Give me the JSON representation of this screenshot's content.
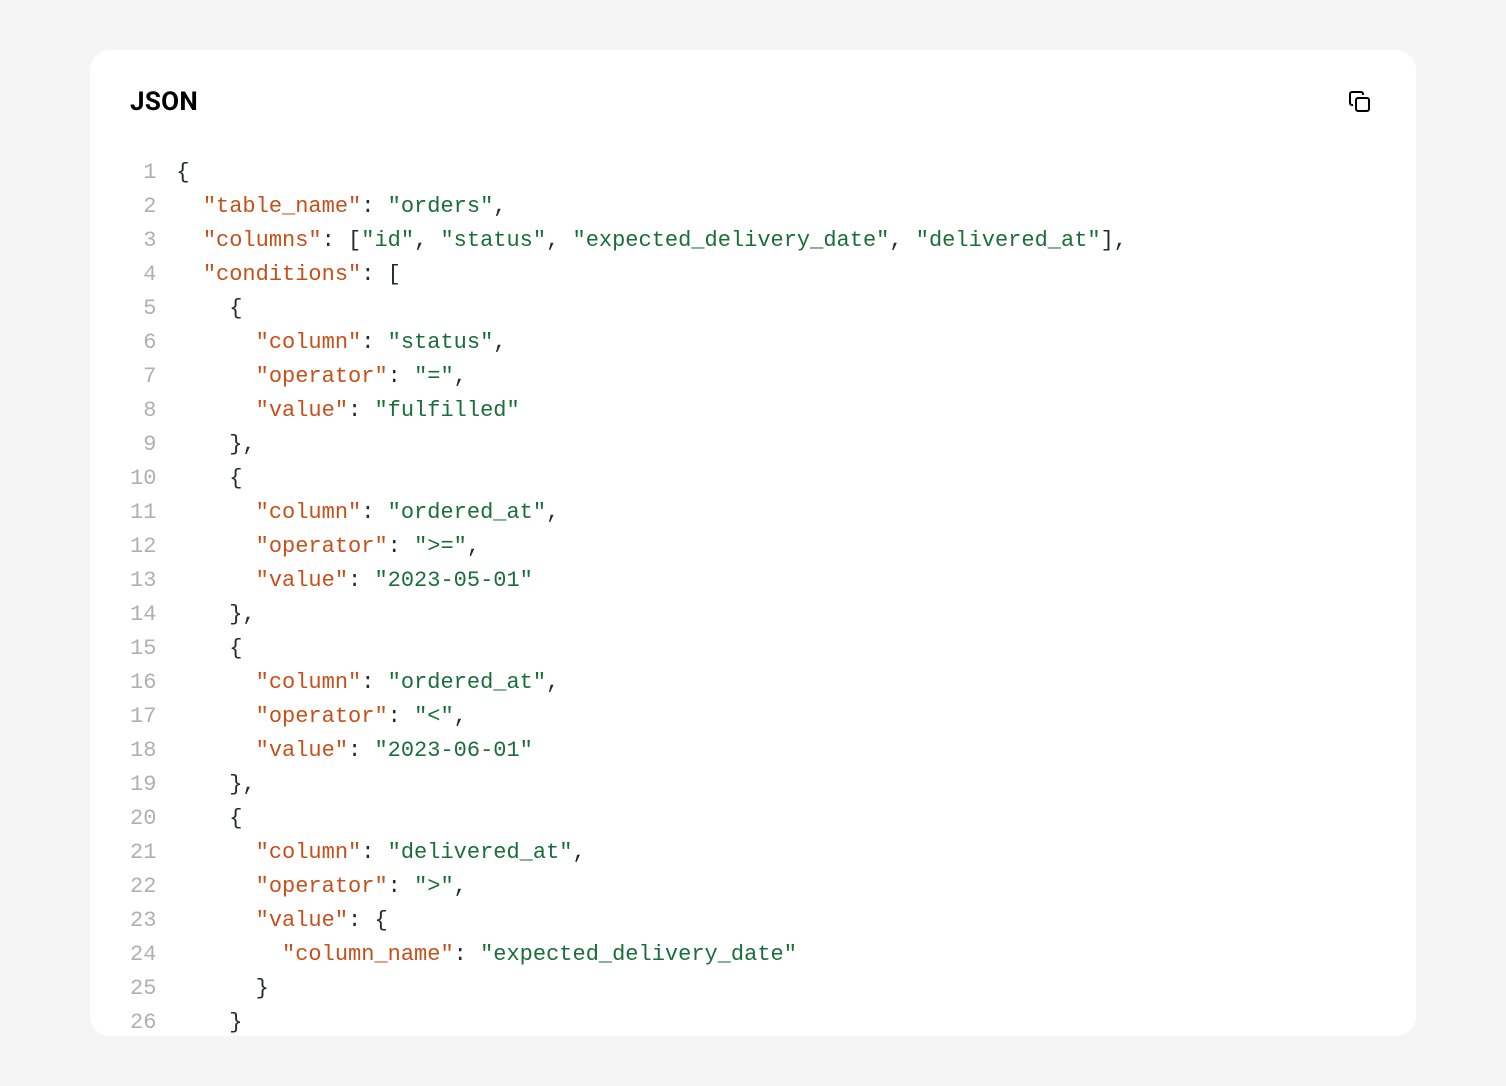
{
  "header": {
    "language_label": "JSON"
  },
  "code": {
    "line_numbers": [
      "1",
      "2",
      "3",
      "4",
      "5",
      "6",
      "7",
      "8",
      "9",
      "10",
      "11",
      "12",
      "13",
      "14",
      "15",
      "16",
      "17",
      "18",
      "19",
      "20",
      "21",
      "22",
      "23",
      "24",
      "25",
      "26"
    ],
    "lines": [
      [
        {
          "t": "punct",
          "v": "{"
        }
      ],
      [
        {
          "t": "indent",
          "v": "  "
        },
        {
          "t": "key",
          "v": "\"table_name\""
        },
        {
          "t": "punct",
          "v": ": "
        },
        {
          "t": "string",
          "v": "\"orders\""
        },
        {
          "t": "punct",
          "v": ","
        }
      ],
      [
        {
          "t": "indent",
          "v": "  "
        },
        {
          "t": "key",
          "v": "\"columns\""
        },
        {
          "t": "punct",
          "v": ": ["
        },
        {
          "t": "string",
          "v": "\"id\""
        },
        {
          "t": "punct",
          "v": ", "
        },
        {
          "t": "string",
          "v": "\"status\""
        },
        {
          "t": "punct",
          "v": ", "
        },
        {
          "t": "string",
          "v": "\"expected_delivery_date\""
        },
        {
          "t": "punct",
          "v": ", "
        },
        {
          "t": "string",
          "v": "\"delivered_at\""
        },
        {
          "t": "punct",
          "v": "],"
        }
      ],
      [
        {
          "t": "indent",
          "v": "  "
        },
        {
          "t": "key",
          "v": "\"conditions\""
        },
        {
          "t": "punct",
          "v": ": ["
        }
      ],
      [
        {
          "t": "indent",
          "v": "    "
        },
        {
          "t": "punct",
          "v": "{"
        }
      ],
      [
        {
          "t": "indent",
          "v": "      "
        },
        {
          "t": "key",
          "v": "\"column\""
        },
        {
          "t": "punct",
          "v": ": "
        },
        {
          "t": "string",
          "v": "\"status\""
        },
        {
          "t": "punct",
          "v": ","
        }
      ],
      [
        {
          "t": "indent",
          "v": "      "
        },
        {
          "t": "key",
          "v": "\"operator\""
        },
        {
          "t": "punct",
          "v": ": "
        },
        {
          "t": "string",
          "v": "\"=\""
        },
        {
          "t": "punct",
          "v": ","
        }
      ],
      [
        {
          "t": "indent",
          "v": "      "
        },
        {
          "t": "key",
          "v": "\"value\""
        },
        {
          "t": "punct",
          "v": ": "
        },
        {
          "t": "string",
          "v": "\"fulfilled\""
        }
      ],
      [
        {
          "t": "indent",
          "v": "    "
        },
        {
          "t": "punct",
          "v": "},"
        }
      ],
      [
        {
          "t": "indent",
          "v": "    "
        },
        {
          "t": "punct",
          "v": "{"
        }
      ],
      [
        {
          "t": "indent",
          "v": "      "
        },
        {
          "t": "key",
          "v": "\"column\""
        },
        {
          "t": "punct",
          "v": ": "
        },
        {
          "t": "string",
          "v": "\"ordered_at\""
        },
        {
          "t": "punct",
          "v": ","
        }
      ],
      [
        {
          "t": "indent",
          "v": "      "
        },
        {
          "t": "key",
          "v": "\"operator\""
        },
        {
          "t": "punct",
          "v": ": "
        },
        {
          "t": "string",
          "v": "\">=\""
        },
        {
          "t": "punct",
          "v": ","
        }
      ],
      [
        {
          "t": "indent",
          "v": "      "
        },
        {
          "t": "key",
          "v": "\"value\""
        },
        {
          "t": "punct",
          "v": ": "
        },
        {
          "t": "string",
          "v": "\"2023-05-01\""
        }
      ],
      [
        {
          "t": "indent",
          "v": "    "
        },
        {
          "t": "punct",
          "v": "},"
        }
      ],
      [
        {
          "t": "indent",
          "v": "    "
        },
        {
          "t": "punct",
          "v": "{"
        }
      ],
      [
        {
          "t": "indent",
          "v": "      "
        },
        {
          "t": "key",
          "v": "\"column\""
        },
        {
          "t": "punct",
          "v": ": "
        },
        {
          "t": "string",
          "v": "\"ordered_at\""
        },
        {
          "t": "punct",
          "v": ","
        }
      ],
      [
        {
          "t": "indent",
          "v": "      "
        },
        {
          "t": "key",
          "v": "\"operator\""
        },
        {
          "t": "punct",
          "v": ": "
        },
        {
          "t": "string",
          "v": "\"<\""
        },
        {
          "t": "punct",
          "v": ","
        }
      ],
      [
        {
          "t": "indent",
          "v": "      "
        },
        {
          "t": "key",
          "v": "\"value\""
        },
        {
          "t": "punct",
          "v": ": "
        },
        {
          "t": "string",
          "v": "\"2023-06-01\""
        }
      ],
      [
        {
          "t": "indent",
          "v": "    "
        },
        {
          "t": "punct",
          "v": "},"
        }
      ],
      [
        {
          "t": "indent",
          "v": "    "
        },
        {
          "t": "punct",
          "v": "{"
        }
      ],
      [
        {
          "t": "indent",
          "v": "      "
        },
        {
          "t": "key",
          "v": "\"column\""
        },
        {
          "t": "punct",
          "v": ": "
        },
        {
          "t": "string",
          "v": "\"delivered_at\""
        },
        {
          "t": "punct",
          "v": ","
        }
      ],
      [
        {
          "t": "indent",
          "v": "      "
        },
        {
          "t": "key",
          "v": "\"operator\""
        },
        {
          "t": "punct",
          "v": ": "
        },
        {
          "t": "string",
          "v": "\">\""
        },
        {
          "t": "punct",
          "v": ","
        }
      ],
      [
        {
          "t": "indent",
          "v": "      "
        },
        {
          "t": "key",
          "v": "\"value\""
        },
        {
          "t": "punct",
          "v": ": {"
        }
      ],
      [
        {
          "t": "indent",
          "v": "        "
        },
        {
          "t": "key",
          "v": "\"column_name\""
        },
        {
          "t": "punct",
          "v": ": "
        },
        {
          "t": "string",
          "v": "\"expected_delivery_date\""
        }
      ],
      [
        {
          "t": "indent",
          "v": "      "
        },
        {
          "t": "punct",
          "v": "}"
        }
      ],
      [
        {
          "t": "indent",
          "v": "    "
        },
        {
          "t": "punct",
          "v": "}"
        }
      ]
    ]
  }
}
